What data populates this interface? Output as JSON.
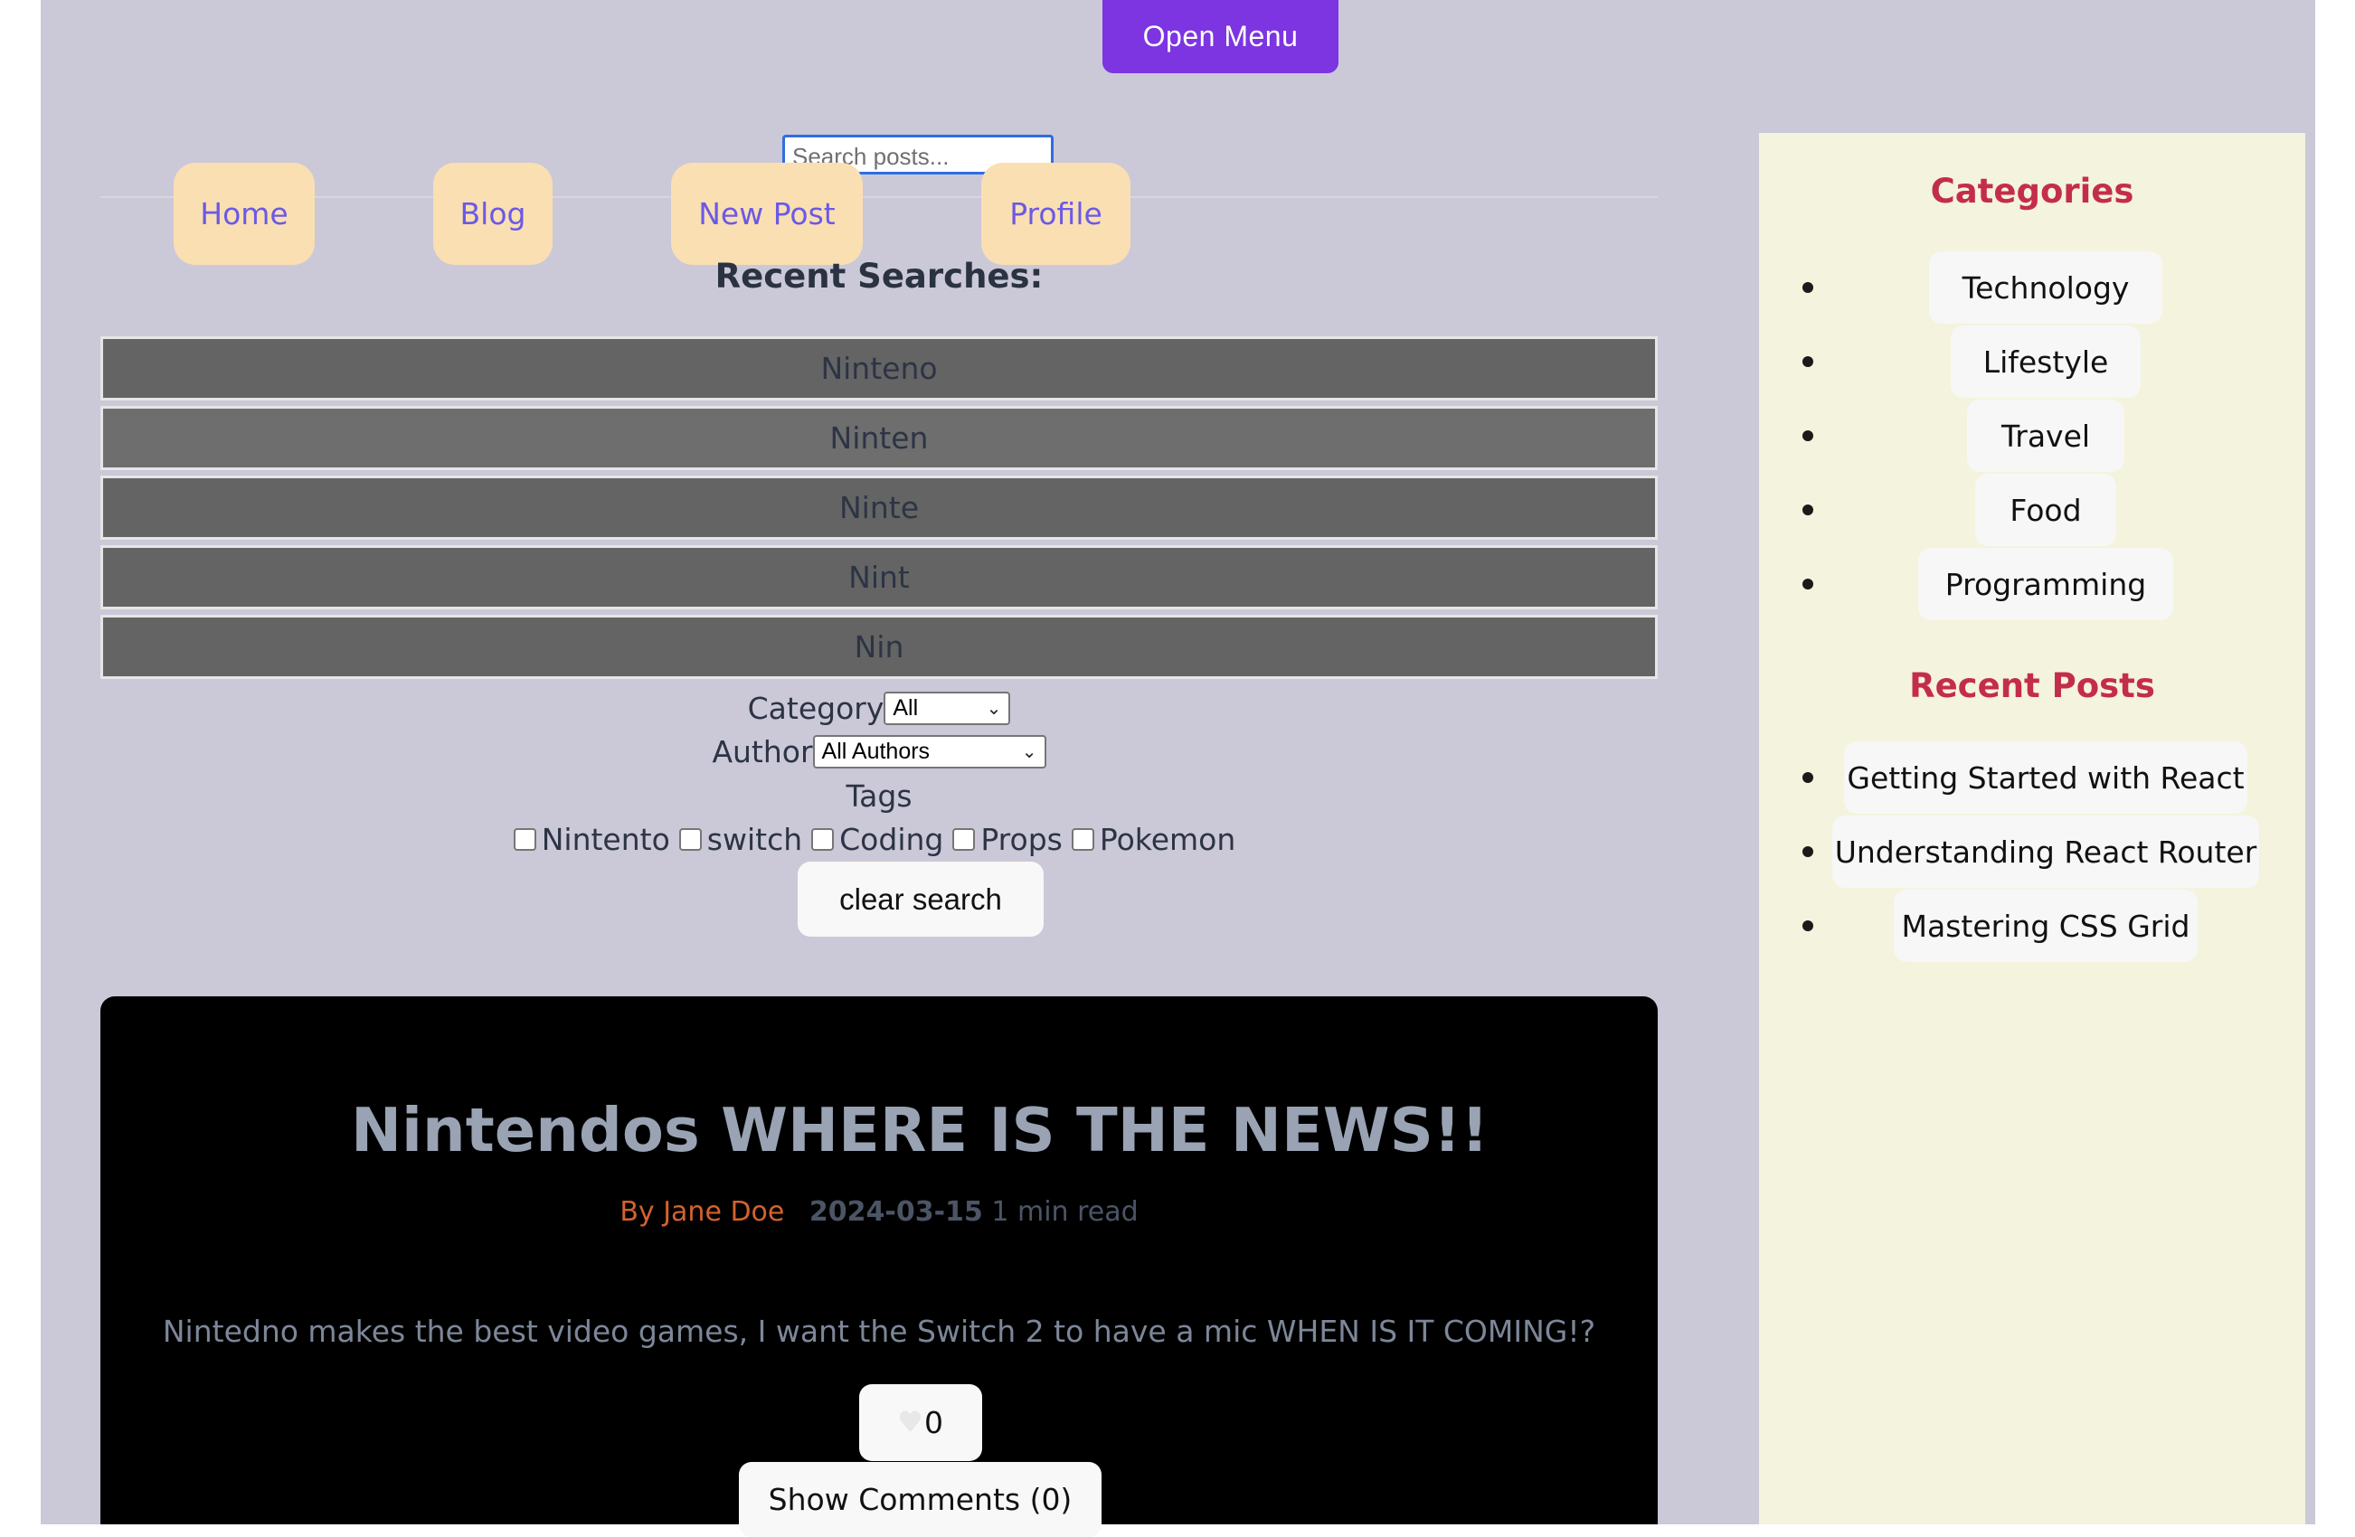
{
  "header": {
    "open_menu_label": "Open Menu"
  },
  "search": {
    "placeholder": "Search posts..."
  },
  "nav": {
    "home": "Home",
    "blog": "Blog",
    "new_post": "New Post",
    "profile": "Profile"
  },
  "recent_searches": {
    "title": "Recent Searches:",
    "items": [
      "Ninteno",
      "Ninten",
      "Ninte",
      "Nint",
      "Nin"
    ]
  },
  "filters": {
    "category_label": "Category",
    "category_value": "All",
    "author_label": "Author",
    "author_value": "All Authors",
    "tags_label": "Tags",
    "tags": [
      "Nintento",
      "switch",
      "Coding",
      "Props",
      "Pokemon"
    ],
    "clear_label": "clear search"
  },
  "post": {
    "title": "Nintendos WHERE IS THE NEWS!!",
    "author": "By Jane Doe",
    "date": "2024-03-15",
    "read_time": "1 min read",
    "excerpt": "Nintedno makes the best video games, I want the Switch 2 to have a mic WHEN IS IT COMING!?",
    "likes": "0",
    "comments_label": "Show Comments (0)"
  },
  "sidebar": {
    "categories_title": "Categories",
    "categories": [
      "Technology",
      "Lifestyle",
      "Travel",
      "Food",
      "Programming"
    ],
    "recent_posts_title": "Recent Posts",
    "recent_posts": [
      "Getting Started with React",
      "Understanding React Router",
      "Mastering CSS Grid"
    ]
  },
  "colors": {
    "page_background": "#cbc8d8",
    "menu_button": "#7c35e0",
    "nav_chip": "#fadfb2",
    "nav_text": "#6a5ae6",
    "sidebar_background": "#f4f3dd",
    "sidebar_heading": "#c42d4a",
    "post_card": "#000000",
    "post_author": "#d4622e"
  }
}
